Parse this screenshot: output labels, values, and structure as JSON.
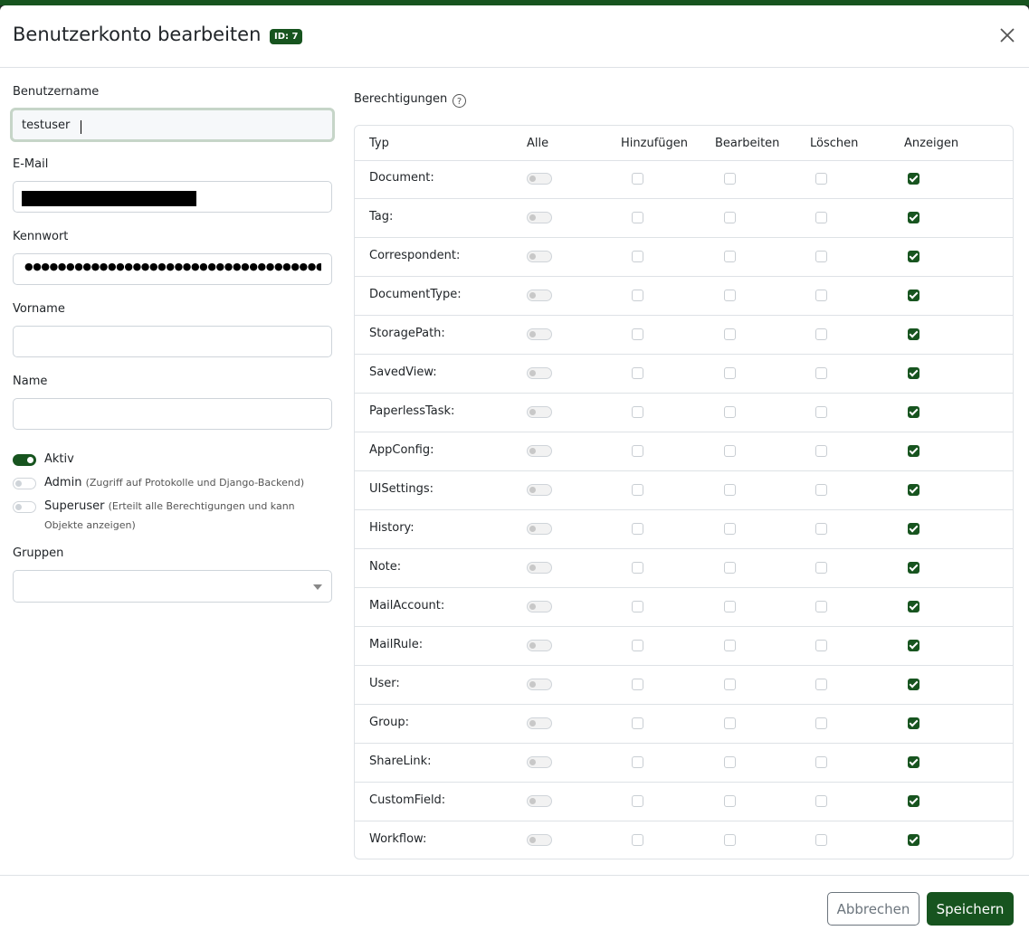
{
  "dialog": {
    "title": "Benutzerkonto bearbeiten",
    "id_badge": "ID: 7"
  },
  "form": {
    "username_label": "Benutzername",
    "username_value": "testuser",
    "email_label": "E-Mail",
    "password_label": "Kennwort",
    "password_mask": "●●●●●●●●●●●●●●●●●●●●●●●●●●●●●●●●●●●●●●●●",
    "firstname_label": "Vorname",
    "firstname_value": "",
    "lastname_label": "Name",
    "lastname_value": "",
    "active_label": "Aktiv",
    "admin_label": "Admin",
    "admin_hint": "(Zugriff auf Protokolle und Django-Backend)",
    "superuser_label": "Superuser",
    "superuser_hint_1": "(Erteilt alle Berechtigungen und kann",
    "superuser_hint_2": "Objekte anzeigen)",
    "groups_label": "Gruppen",
    "active": true,
    "admin": false,
    "superuser": false
  },
  "permissions": {
    "title": "Berechtigungen",
    "help_symbol": "?",
    "columns": {
      "type": "Typ",
      "all": "Alle",
      "add": "Hinzufügen",
      "change": "Bearbeiten",
      "delete": "Löschen",
      "view": "Anzeigen"
    },
    "rows": [
      {
        "name": "Document:",
        "all": false,
        "add": false,
        "change": false,
        "delete": false,
        "view": true
      },
      {
        "name": "Tag:",
        "all": false,
        "add": false,
        "change": false,
        "delete": false,
        "view": true
      },
      {
        "name": "Correspondent:",
        "all": false,
        "add": false,
        "change": false,
        "delete": false,
        "view": true
      },
      {
        "name": "DocumentType:",
        "all": false,
        "add": false,
        "change": false,
        "delete": false,
        "view": true
      },
      {
        "name": "StoragePath:",
        "all": false,
        "add": false,
        "change": false,
        "delete": false,
        "view": true
      },
      {
        "name": "SavedView:",
        "all": false,
        "add": false,
        "change": false,
        "delete": false,
        "view": true
      },
      {
        "name": "PaperlessTask:",
        "all": false,
        "add": false,
        "change": false,
        "delete": false,
        "view": true
      },
      {
        "name": "AppConfig:",
        "all": false,
        "add": false,
        "change": false,
        "delete": false,
        "view": true
      },
      {
        "name": "UISettings:",
        "all": false,
        "add": false,
        "change": false,
        "delete": false,
        "view": true
      },
      {
        "name": "History:",
        "all": false,
        "add": false,
        "change": false,
        "delete": false,
        "view": true
      },
      {
        "name": "Note:",
        "all": false,
        "add": false,
        "change": false,
        "delete": false,
        "view": true
      },
      {
        "name": "MailAccount:",
        "all": false,
        "add": false,
        "change": false,
        "delete": false,
        "view": true
      },
      {
        "name": "MailRule:",
        "all": false,
        "add": false,
        "change": false,
        "delete": false,
        "view": true
      },
      {
        "name": "User:",
        "all": false,
        "add": false,
        "change": false,
        "delete": false,
        "view": true
      },
      {
        "name": "Group:",
        "all": false,
        "add": false,
        "change": false,
        "delete": false,
        "view": true
      },
      {
        "name": "ShareLink:",
        "all": false,
        "add": false,
        "change": false,
        "delete": false,
        "view": true
      },
      {
        "name": "CustomField:",
        "all": false,
        "add": false,
        "change": false,
        "delete": false,
        "view": true
      },
      {
        "name": "Workflow:",
        "all": false,
        "add": false,
        "change": false,
        "delete": false,
        "view": true
      }
    ]
  },
  "footer": {
    "cancel_label": "Abbrechen",
    "save_label": "Speichern"
  },
  "colors": {
    "primary": "#17541f",
    "border": "#dee2e6"
  }
}
